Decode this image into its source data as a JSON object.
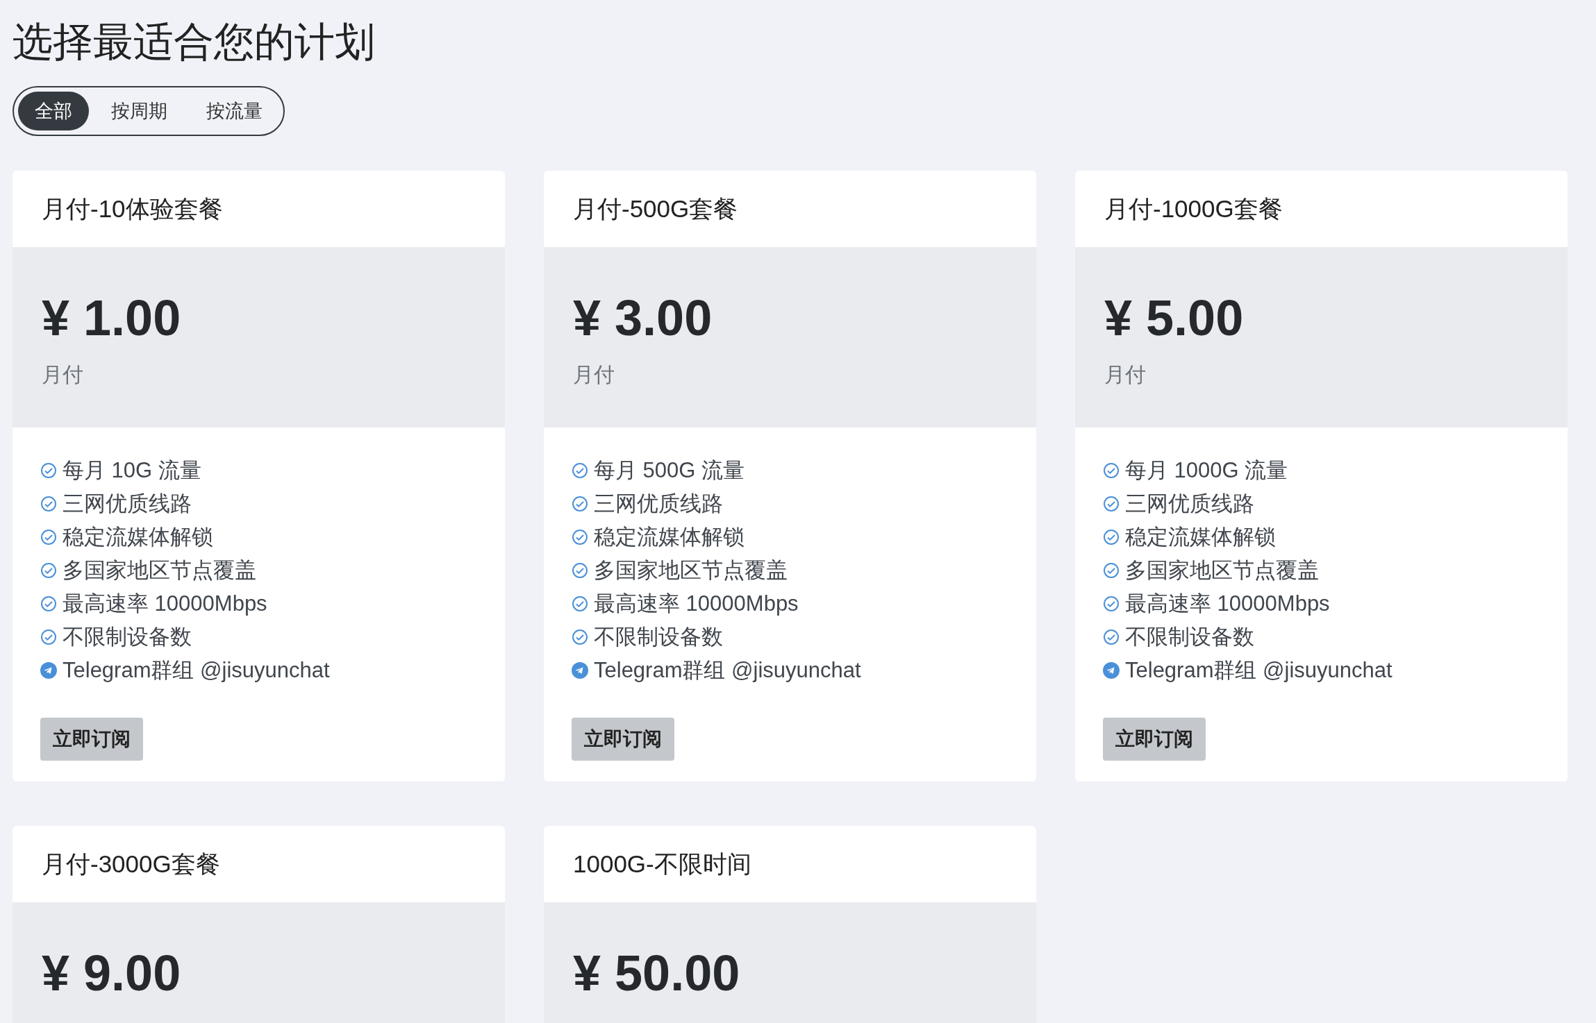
{
  "title": "选择最适合您的计划",
  "tabs": [
    {
      "label": "全部",
      "selected": true
    },
    {
      "label": "按周期",
      "selected": false
    },
    {
      "label": "按流量",
      "selected": false
    }
  ],
  "plans": [
    {
      "name": "月付-10体验套餐",
      "price": "¥ 1.00",
      "period": "月付",
      "features": [
        {
          "kind": "check",
          "text": "每月 10G 流量"
        },
        {
          "kind": "check",
          "text": "三网优质线路"
        },
        {
          "kind": "check",
          "text": "稳定流媒体解锁"
        },
        {
          "kind": "check",
          "text": "多国家地区节点覆盖"
        },
        {
          "kind": "check",
          "text": "最高速率 10000Mbps"
        },
        {
          "kind": "check",
          "text": "不限制设备数"
        },
        {
          "kind": "telegram",
          "text": "Telegram群组 @jisuyunchat"
        }
      ],
      "button": "立即订阅"
    },
    {
      "name": "月付-500G套餐",
      "price": "¥ 3.00",
      "period": "月付",
      "features": [
        {
          "kind": "check",
          "text": "每月 500G 流量"
        },
        {
          "kind": "check",
          "text": "三网优质线路"
        },
        {
          "kind": "check",
          "text": "稳定流媒体解锁"
        },
        {
          "kind": "check",
          "text": "多国家地区节点覆盖"
        },
        {
          "kind": "check",
          "text": "最高速率 10000Mbps"
        },
        {
          "kind": "check",
          "text": "不限制设备数"
        },
        {
          "kind": "telegram",
          "text": "Telegram群组 @jisuyunchat"
        }
      ],
      "button": "立即订阅"
    },
    {
      "name": "月付-1000G套餐",
      "price": "¥ 5.00",
      "period": "月付",
      "features": [
        {
          "kind": "check",
          "text": "每月 1000G 流量"
        },
        {
          "kind": "check",
          "text": "三网优质线路"
        },
        {
          "kind": "check",
          "text": "稳定流媒体解锁"
        },
        {
          "kind": "check",
          "text": "多国家地区节点覆盖"
        },
        {
          "kind": "check",
          "text": "最高速率 10000Mbps"
        },
        {
          "kind": "check",
          "text": "不限制设备数"
        },
        {
          "kind": "telegram",
          "text": "Telegram群组 @jisuyunchat"
        }
      ],
      "button": "立即订阅"
    },
    {
      "name": "月付-3000G套餐",
      "price": "¥ 9.00"
    },
    {
      "name": "1000G-不限时间",
      "price": "¥ 50.00"
    }
  ]
}
